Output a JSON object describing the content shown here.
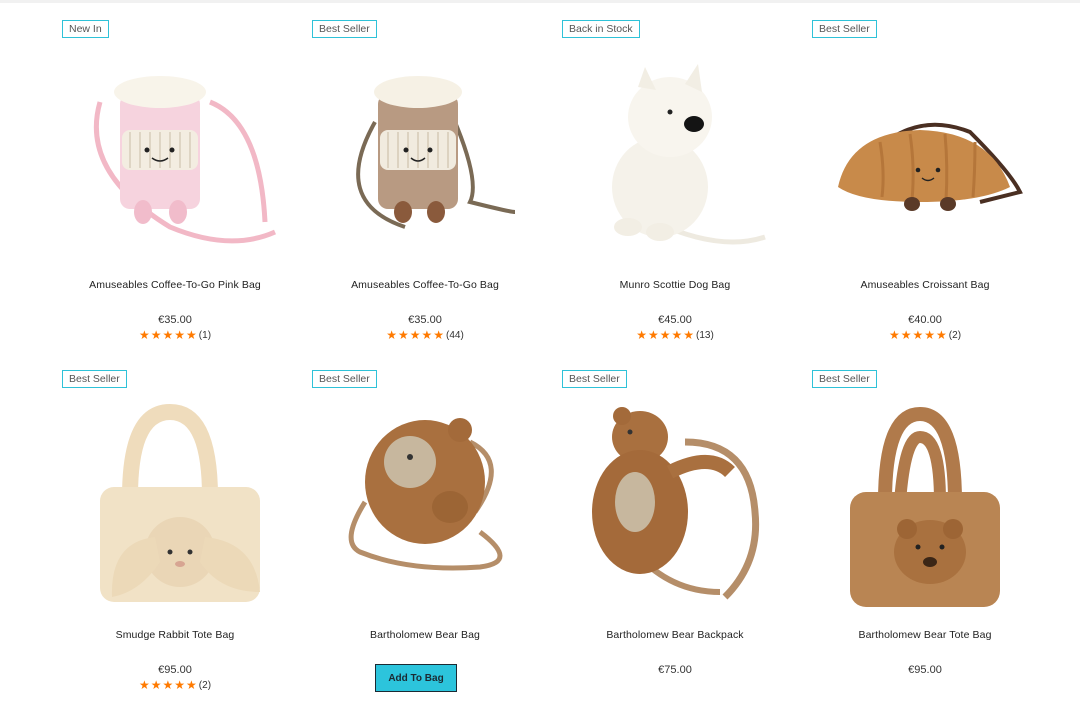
{
  "colors": {
    "badge_border": "#2fc2d8",
    "star": "#ff7a00",
    "button_bg": "#2cc4dc"
  },
  "products": [
    {
      "badge": "New In",
      "name": "Amuseables Coffee-To-Go Pink Bag",
      "price": "€35.00",
      "rating": 5,
      "reviews": "(1)",
      "image": "pink-coffee-cup-plush-bag"
    },
    {
      "badge": "Best Seller",
      "name": "Amuseables Coffee-To-Go Bag",
      "price": "€35.00",
      "rating": 5,
      "reviews": "(44)",
      "image": "coffee-cup-plush-bag"
    },
    {
      "badge": "Back in Stock",
      "name": "Munro Scottie Dog Bag",
      "price": "€45.00",
      "rating": 5,
      "reviews": "(13)",
      "image": "white-scottie-dog-plush-bag"
    },
    {
      "badge": "Best Seller",
      "name": "Amuseables Croissant Bag",
      "price": "€40.00",
      "rating": 5,
      "reviews": "(2)",
      "image": "croissant-plush-bag"
    },
    {
      "badge": "Best Seller",
      "name": "Smudge Rabbit Tote Bag",
      "price": "€95.00",
      "rating": 5,
      "reviews": "(2)",
      "image": "rabbit-tote-bag"
    },
    {
      "badge": "Best Seller",
      "name": "Bartholomew Bear Bag",
      "add_to_bag_label": "Add To Bag",
      "image": "bear-crossbody-bag"
    },
    {
      "badge": "Best Seller",
      "name": "Bartholomew Bear Backpack",
      "price": "€75.00",
      "image": "bear-backpack"
    },
    {
      "badge": "Best Seller",
      "name": "Bartholomew Bear Tote Bag",
      "price": "€95.00",
      "image": "bear-tote-bag"
    }
  ]
}
